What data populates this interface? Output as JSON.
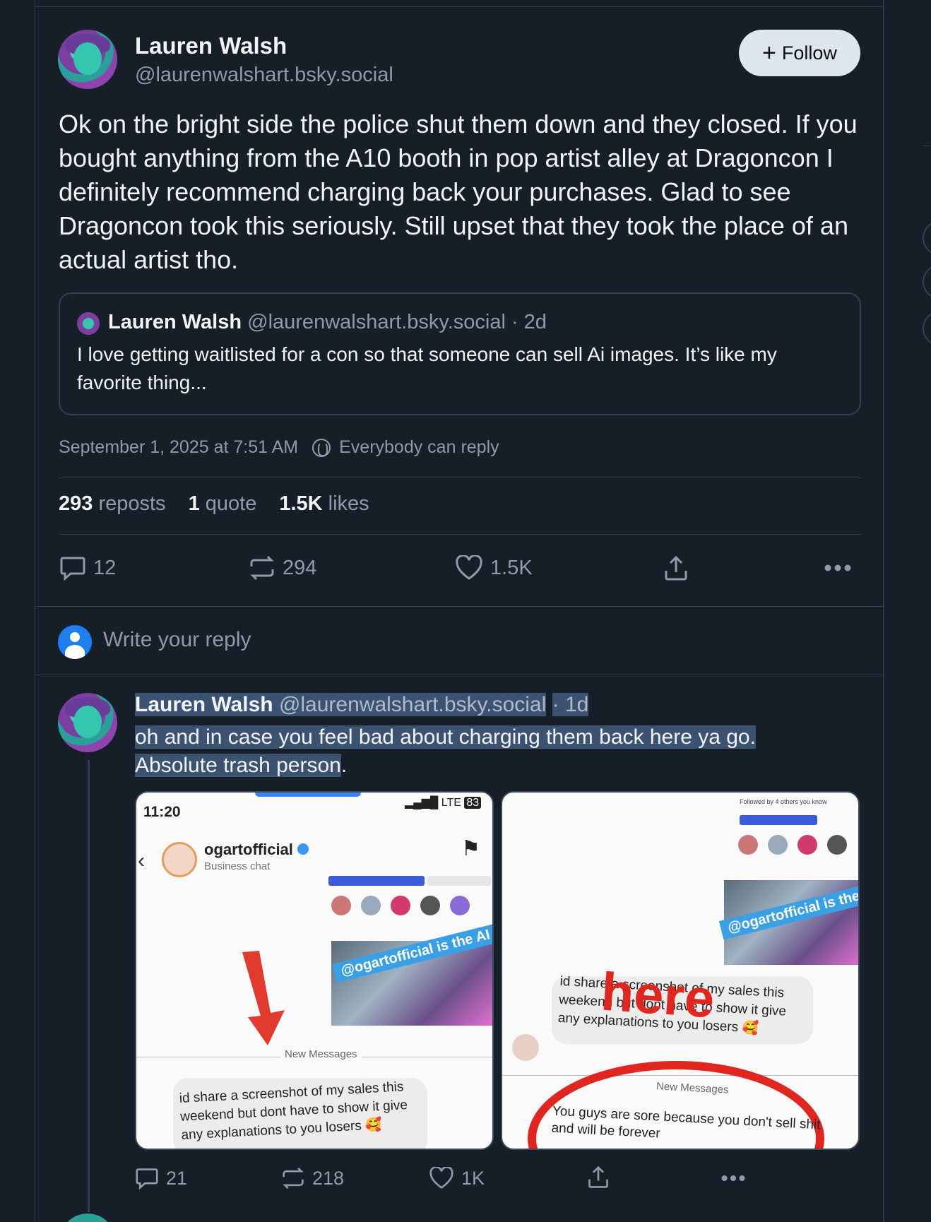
{
  "post": {
    "author_name": "Lauren Walsh",
    "author_handle": "@laurenwalshart.bsky.social",
    "follow_label": "Follow",
    "text": "Ok on the bright side the police shut them down and they closed. If you bought anything from the A10 booth in pop artist alley at Dragoncon I definitely recommend charging back your purchases. Glad to see Dragoncon took this seriously. Still upset that they took the place of an actual artist tho.",
    "quote": {
      "author_name": "Lauren Walsh",
      "author_handle": "@laurenwalshart.bsky.social · 2d",
      "text": "I love getting waitlisted for a con so that someone can sell Ai images. It’s like my favorite thing..."
    },
    "timestamp": "September 1, 2025 at 7:51 AM",
    "reply_setting": "Everybody can reply",
    "stats": {
      "reposts_count": "293",
      "reposts_label": "reposts",
      "quotes_count": "1",
      "quotes_label": "quote",
      "likes_count": "1.5K",
      "likes_label": "likes"
    },
    "actions": {
      "replies": "12",
      "reposts": "294",
      "likes": "1.5K"
    }
  },
  "reply_box": {
    "placeholder": "Write your reply"
  },
  "reply": {
    "author_name": "Lauren Walsh",
    "author_handle": "@laurenwalshart.bsky.social",
    "time": "· 1d",
    "text_line1": "oh and in case you feel bad about charging them back here ya go.",
    "text_line2_selected": "Absolute trash person",
    "text_line2_rest": ".",
    "image1": {
      "time": "11:20",
      "network": "LTE",
      "battery": "83",
      "account": "ogartofficial",
      "subtitle": "Business chat",
      "banner": "@ogartofficial is the AI culprit",
      "divider": "New Messages",
      "message": "id share a screenshot of my sales this weekend but dont have to show it give any explanations to you losers 🥰"
    },
    "image2": {
      "followed_by": "Followed by 4 others you know",
      "banner": "@ogartofficial is the culprit",
      "message": "id share a screenshot of my sales this weekend but dont have to show it give any explanations to you losers 🥰",
      "overlay": "here",
      "divider": "New Messages",
      "message2": "You guys are sore because you don't sell shit and will be forever"
    },
    "actions": {
      "replies": "21",
      "reposts": "218",
      "likes": "1K"
    }
  },
  "colors": {
    "background": "#161e27",
    "border": "#2e4052",
    "muted": "#8d9bab",
    "accent": "#1f7ef0",
    "selection": "#3b5270"
  },
  "icons": [
    "reply-icon",
    "repost-icon",
    "like-icon",
    "share-icon",
    "more-icon",
    "globe-icon",
    "plus-icon"
  ]
}
